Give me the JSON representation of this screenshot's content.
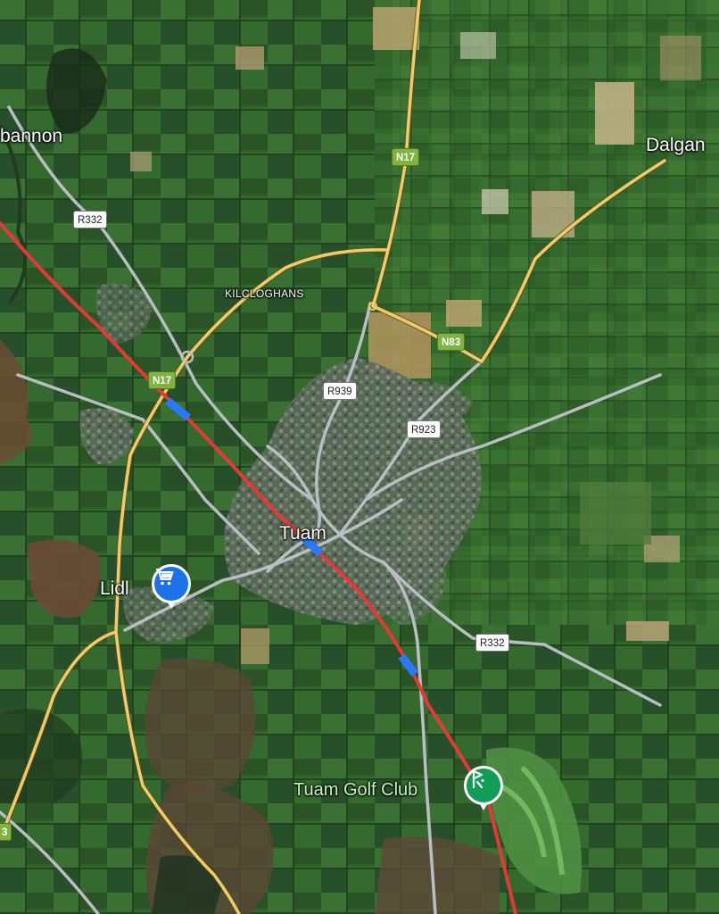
{
  "map": {
    "towns": {
      "tuam": "Tuam",
      "kilcloghans": "KILCLOGHANS",
      "bannon": "bannon",
      "dalgan": "Dalgan"
    },
    "road_shields": {
      "n17_top": "N17",
      "n17_mid": "N17",
      "n83": "N83",
      "n83_edge": "3",
      "r332_left": "R332",
      "r332_right": "R332",
      "r939": "R939",
      "r923": "R923"
    },
    "places": {
      "lidl": {
        "name": "Lidl",
        "icon": "shopping-cart-icon",
        "color": "#1a73e8"
      },
      "golf": {
        "name": "Tuam Golf Club",
        "icon": "golf-icon",
        "color": "#0f9d58",
        "label_color": "#c9f0c6"
      }
    },
    "colors": {
      "route": "#e53935",
      "route_marker": "#2979ff",
      "national_road": "#f0cb6a",
      "regional_road": "#b9bec4",
      "land": "#2e5a2a"
    }
  }
}
